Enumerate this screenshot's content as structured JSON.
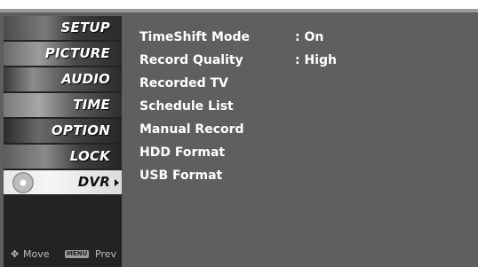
{
  "sidebar": {
    "items": [
      {
        "label": "SETUP",
        "icon": "setup-thumb-icon",
        "active": false
      },
      {
        "label": "PICTURE",
        "icon": "picture-thumb-icon",
        "active": false
      },
      {
        "label": "AUDIO",
        "icon": "audio-thumb-icon",
        "active": false
      },
      {
        "label": "TIME",
        "icon": "time-thumb-icon",
        "active": false
      },
      {
        "label": "OPTION",
        "icon": "option-thumb-icon",
        "active": false
      },
      {
        "label": "LOCK",
        "icon": "lock-thumb-icon",
        "active": false
      },
      {
        "label": "DVR",
        "icon": "dvr-disc-icon",
        "active": true
      }
    ],
    "footer": {
      "move_label": "Move",
      "menu_key": "MENU",
      "prev_label": "Prev"
    }
  },
  "content": {
    "rows": [
      {
        "name": "TimeShift Mode",
        "value": ": On"
      },
      {
        "name": "Record Quality",
        "value": ":  High"
      },
      {
        "name": "Recorded TV",
        "value": ""
      },
      {
        "name": "Schedule List",
        "value": ""
      },
      {
        "name": "Manual Record",
        "value": ""
      },
      {
        "name": "HDD Format",
        "value": ""
      },
      {
        "name": "USB Format",
        "value": ""
      }
    ]
  },
  "colors": {
    "panel": "#5f5f5f",
    "sidebar": "#232323",
    "active_item": "#ececec",
    "text": "#ffffff"
  }
}
